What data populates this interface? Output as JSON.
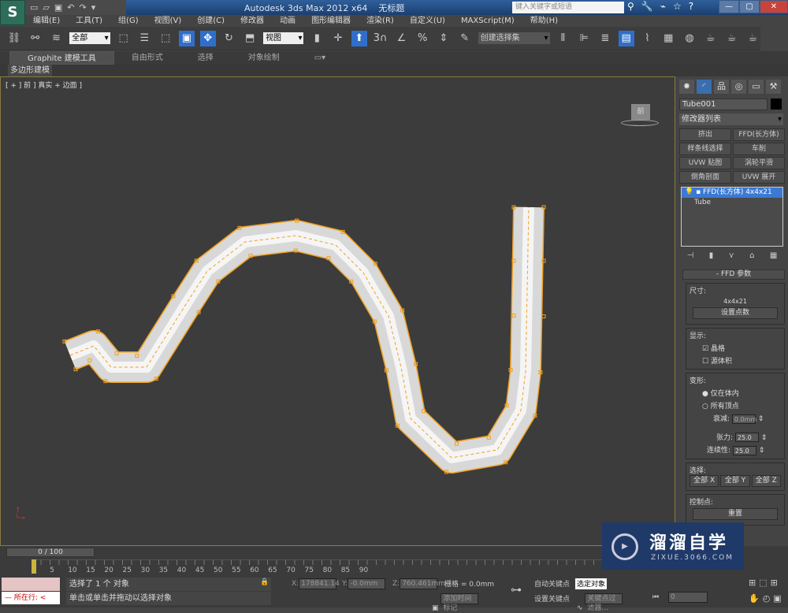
{
  "app": {
    "title": "Autodesk 3ds Max  2012 x64",
    "doc": "无标题",
    "logo": "S",
    "search_placeholder": "键入关键字或短语"
  },
  "menu": [
    "编辑(E)",
    "工具(T)",
    "组(G)",
    "视图(V)",
    "创建(C)",
    "修改器",
    "动画",
    "图形编辑器",
    "渲染(R)",
    "自定义(U)",
    "MAXScript(M)",
    "帮助(H)"
  ],
  "toolbar": {
    "filter": "全部",
    "refcoord": "视图",
    "selset": "创建选择集",
    "snap_label": "3"
  },
  "ribbon": {
    "tabs": [
      "Graphite 建模工具",
      "自由形式",
      "选择",
      "对象绘制"
    ],
    "sub": "多边形建模"
  },
  "viewport": {
    "label": "[ + ] 前 ] 真实 + 边面 ]",
    "cube": "前"
  },
  "panel": {
    "object_name": "Tube001",
    "modifier_list": "修改器列表",
    "mod_buttons": [
      "挤出",
      "FFD(长方体)",
      "样条线选择",
      "车削",
      "UVW 贴图",
      "涡轮平滑",
      "倒角剖面",
      "UVW 展开"
    ],
    "stack": [
      "FFD(长方体) 4x4x21",
      "Tube"
    ],
    "rollout": "FFD 参数",
    "dims_label": "尺寸:",
    "dims": "4x4x21",
    "set_points": "设置点数",
    "display_label": "显示:",
    "lattice": "晶格",
    "lattice_checked": true,
    "source_volume": "源体积",
    "source_checked": false,
    "deform_label": "变形:",
    "only_inside": "仅在体内",
    "all_vertices": "所有顶点",
    "falloff_label": "衰减:",
    "falloff": "0.0mm",
    "tension_label": "张力:",
    "tension": "25.0",
    "continuity_label": "连续性:",
    "continuity": "25.0",
    "select_label": "选择:",
    "sel_x": "全部 X",
    "sel_y": "全部 Y",
    "sel_z": "全部 Z",
    "cp_label": "控制点:",
    "reset": "重置"
  },
  "bottom": {
    "frame": "0 / 100",
    "ticks": [
      "0",
      "5",
      "10",
      "15",
      "20",
      "25",
      "30",
      "35",
      "40",
      "45",
      "50",
      "55",
      "60",
      "65",
      "70",
      "75",
      "80",
      "85",
      "90"
    ],
    "status": "选择了 1 个 对象",
    "prompt": "单击或单击并拖动以选择对象",
    "script_label": "所在行:",
    "x_label": "X:",
    "x": "178841.14",
    "y_label": "Y:",
    "y": "-0.0mm",
    "z_label": "Z:",
    "z": "760.461mm",
    "grid": "栅格 = 0.0mm",
    "add_tag": "添加时间标记",
    "auto_key": "自动关键点",
    "set_key": "设置关键点",
    "sel_obj": "选定对象",
    "key_filter": "关键点过滤器...",
    "frame_field": "0"
  },
  "watermark": {
    "name": "溜溜自学",
    "url": "ZIXUE.3066.COM"
  },
  "colors": {
    "accent": "#2f6fcb",
    "lattice": "#f0a020",
    "viewport_bg": "#3c3c3c"
  }
}
